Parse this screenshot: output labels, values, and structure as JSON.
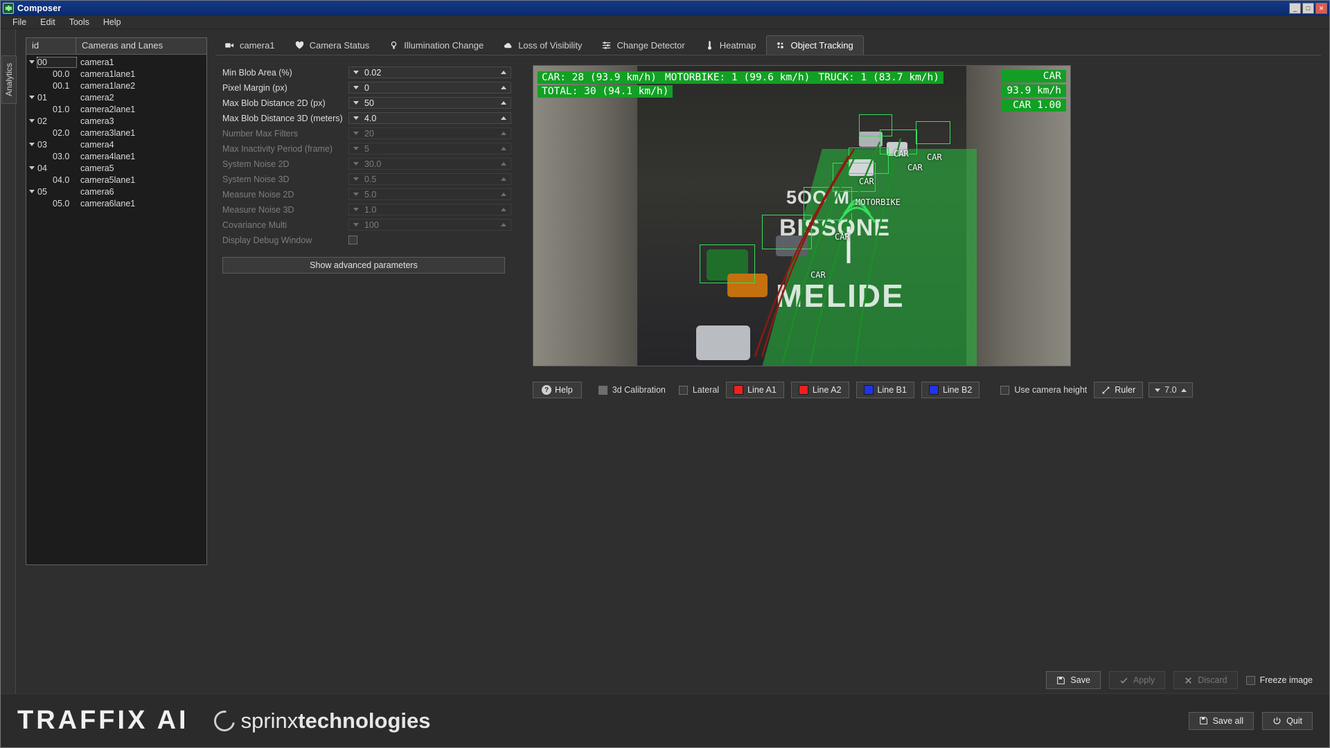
{
  "window": {
    "title": "Composer",
    "icon": "gear-icon",
    "buttons": {
      "minimize": "_",
      "maximize": "□",
      "close": "✕"
    }
  },
  "menu": {
    "items": [
      "File",
      "Edit",
      "Tools",
      "Help"
    ]
  },
  "vertical_tabs": [
    {
      "label": "Analytics"
    }
  ],
  "tree": {
    "columns": [
      "id",
      "Cameras and Lanes"
    ],
    "rows": [
      {
        "id": "00",
        "label": "camera1",
        "level": 0,
        "expandable": true,
        "selected": true
      },
      {
        "id": "00.0",
        "label": "camera1lane1",
        "level": 1,
        "expandable": false,
        "selected": false
      },
      {
        "id": "00.1",
        "label": "camera1lane2",
        "level": 1,
        "expandable": false,
        "selected": false
      },
      {
        "id": "01",
        "label": "camera2",
        "level": 0,
        "expandable": true,
        "selected": false
      },
      {
        "id": "01.0",
        "label": "camera2lane1",
        "level": 1,
        "expandable": false,
        "selected": false
      },
      {
        "id": "02",
        "label": "camera3",
        "level": 0,
        "expandable": true,
        "selected": false
      },
      {
        "id": "02.0",
        "label": "camera3lane1",
        "level": 1,
        "expandable": false,
        "selected": false
      },
      {
        "id": "03",
        "label": "camera4",
        "level": 0,
        "expandable": true,
        "selected": false
      },
      {
        "id": "03.0",
        "label": "camera4lane1",
        "level": 1,
        "expandable": false,
        "selected": false
      },
      {
        "id": "04",
        "label": "camera5",
        "level": 0,
        "expandable": true,
        "selected": false
      },
      {
        "id": "04.0",
        "label": "camera5lane1",
        "level": 1,
        "expandable": false,
        "selected": false
      },
      {
        "id": "05",
        "label": "camera6",
        "level": 0,
        "expandable": true,
        "selected": false
      },
      {
        "id": "05.0",
        "label": "camera6lane1",
        "level": 1,
        "expandable": false,
        "selected": false
      }
    ]
  },
  "tabs": [
    {
      "label": "camera1",
      "icon": "video-camera-icon",
      "active": false
    },
    {
      "label": "Camera Status",
      "icon": "heartbeat-icon",
      "active": false
    },
    {
      "label": "Illumination Change",
      "icon": "lightbulb-icon",
      "active": false
    },
    {
      "label": "Loss of Visibility",
      "icon": "cloud-icon",
      "active": false
    },
    {
      "label": "Change Detector",
      "icon": "sliders-icon",
      "active": false
    },
    {
      "label": "Heatmap",
      "icon": "thermometer-icon",
      "active": false
    },
    {
      "label": "Object Tracking",
      "icon": "tracking-icon",
      "active": true
    }
  ],
  "parameters": [
    {
      "label": "Min Blob Area  (%)",
      "value": "0.02",
      "disabled": false,
      "type": "spinner"
    },
    {
      "label": "Pixel Margin  (px)",
      "value": "0",
      "disabled": false,
      "type": "spinner"
    },
    {
      "label": "Max Blob Distance 2D  (px)",
      "value": "50",
      "disabled": false,
      "type": "spinner"
    },
    {
      "label": "Max Blob Distance 3D  (meters)",
      "value": "4.0",
      "disabled": false,
      "type": "spinner"
    },
    {
      "label": "Number Max Filters",
      "value": "20",
      "disabled": true,
      "type": "spinner"
    },
    {
      "label": "Max Inactivity Period  (frame)",
      "value": "5",
      "disabled": true,
      "type": "spinner"
    },
    {
      "label": "System Noise 2D",
      "value": "30.0",
      "disabled": true,
      "type": "spinner"
    },
    {
      "label": "System Noise 3D",
      "value": "0.5",
      "disabled": true,
      "type": "spinner"
    },
    {
      "label": "Measure Noise 2D",
      "value": "5.0",
      "disabled": true,
      "type": "spinner"
    },
    {
      "label": "Measure Noise 3D",
      "value": "1.0",
      "disabled": true,
      "type": "spinner"
    },
    {
      "label": "Covariance Multi",
      "value": "100",
      "disabled": true,
      "type": "spinner"
    },
    {
      "label": "Display Debug Window",
      "value": "",
      "disabled": true,
      "type": "checkbox",
      "checked": false
    }
  ],
  "advanced_button": {
    "label": "Show advanced parameters"
  },
  "video": {
    "stats": [
      "CAR: 28 (93.9 km/h)",
      "MOTORBIKE: 1 (99.6 km/h)",
      "TRUCK: 1 (83.7 km/h)",
      "TOTAL: 30 (94.1 km/h)"
    ],
    "right_chips": [
      "CAR",
      "93.9 km/h",
      "CAR 1.00"
    ],
    "scene_text": [
      "BISSONE",
      "MELIDE",
      "5OO M"
    ],
    "object_labels": [
      "CAR",
      "CAR",
      "CAR",
      "CAR",
      "CAR",
      "MOTORBIKE",
      "CAR"
    ]
  },
  "video_toolbar": {
    "help": {
      "label": "Help",
      "icon": "question-icon"
    },
    "checkboxes": [
      {
        "label": "3d Calibration",
        "checked": true
      },
      {
        "label": "Lateral",
        "checked": false
      }
    ],
    "line_buttons": [
      {
        "label": "Line A1",
        "color": "#ef2020"
      },
      {
        "label": "Line A2",
        "color": "#ef2020"
      },
      {
        "label": "Line B1",
        "color": "#2233e8"
      },
      {
        "label": "Line B2",
        "color": "#2233e8"
      }
    ],
    "use_camera_height": {
      "label": "Use camera height",
      "checked": false
    },
    "ruler": {
      "label": "Ruler",
      "icon": "ruler-icon"
    },
    "ruler_value": "7.0"
  },
  "actions": {
    "save": {
      "label": "Save",
      "icon": "floppy-icon",
      "disabled": false
    },
    "apply": {
      "label": "Apply",
      "icon": "check-icon",
      "disabled": true
    },
    "discard": {
      "label": "Discard",
      "icon": "cross-icon",
      "disabled": true
    },
    "freeze": {
      "label": "Freeze image",
      "checked": false
    }
  },
  "footer": {
    "brand_primary": "TRAFFIX AI",
    "brand_secondary_light": "sprinx",
    "brand_secondary_bold": "technologies",
    "save_all": {
      "label": "Save all",
      "icon": "floppy-icon"
    },
    "quit": {
      "label": "Quit",
      "icon": "power-icon"
    }
  }
}
